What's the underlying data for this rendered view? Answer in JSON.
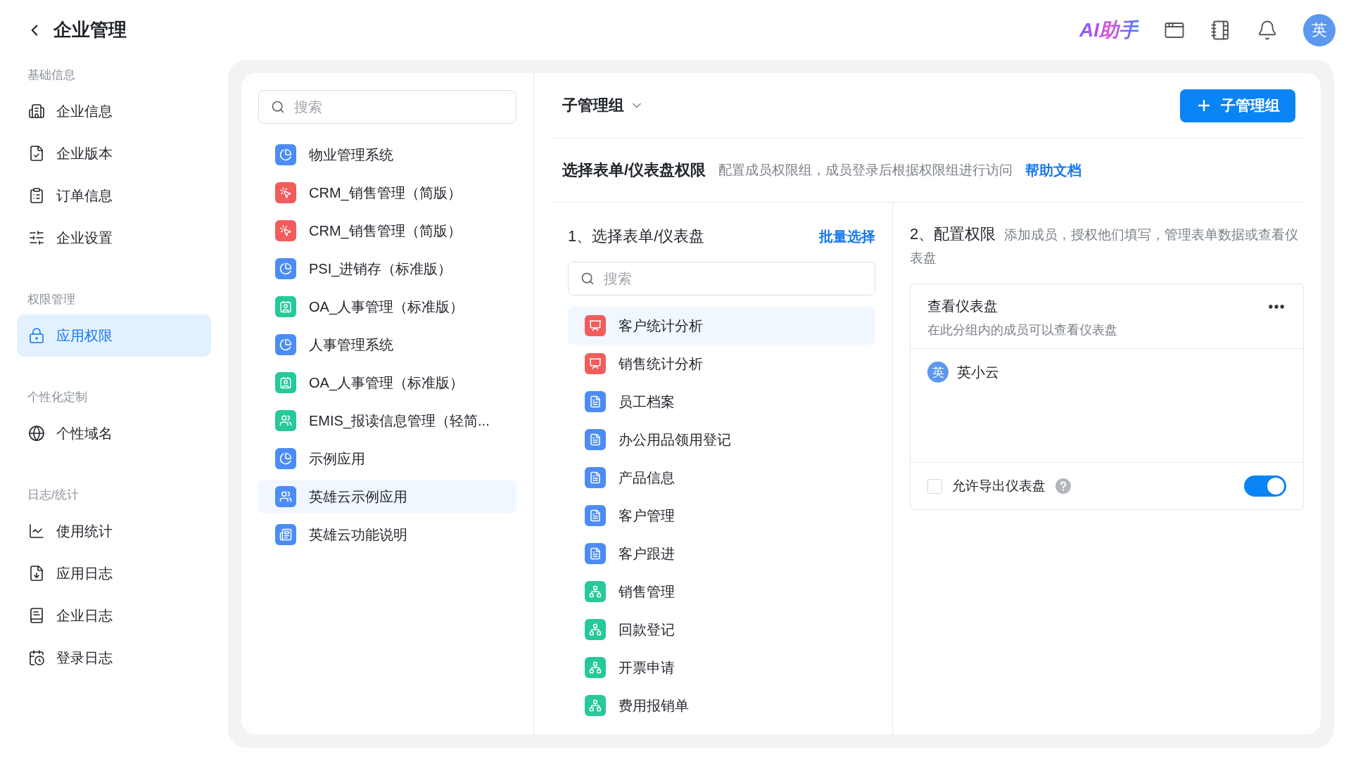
{
  "header": {
    "title": "企业管理",
    "ai_label": "AI助手",
    "avatar": "英"
  },
  "sidebar": {
    "sections": [
      {
        "label": "基础信息",
        "items": [
          {
            "label": "企业信息",
            "selected": false
          },
          {
            "label": "企业版本",
            "selected": false
          },
          {
            "label": "订单信息",
            "selected": false
          },
          {
            "label": "企业设置",
            "selected": false
          }
        ]
      },
      {
        "label": "权限管理",
        "items": [
          {
            "label": "应用权限",
            "selected": true
          }
        ]
      },
      {
        "label": "个性化定制",
        "items": [
          {
            "label": "个性域名",
            "selected": false
          }
        ]
      },
      {
        "label": "日志/统计",
        "items": [
          {
            "label": "使用统计",
            "selected": false
          },
          {
            "label": "应用日志",
            "selected": false
          },
          {
            "label": "企业日志",
            "selected": false
          },
          {
            "label": "登录日志",
            "selected": false
          }
        ]
      }
    ]
  },
  "apps": {
    "search_placeholder": "搜索",
    "items": [
      {
        "label": "物业管理系统",
        "kind": "pie",
        "color": "#4c8cf5",
        "selected": false
      },
      {
        "label": "CRM_销售管理（简版）",
        "kind": "web",
        "color": "#f25c5c",
        "selected": false
      },
      {
        "label": "CRM_销售管理（简版）",
        "kind": "web",
        "color": "#f25c5c",
        "selected": false
      },
      {
        "label": "PSI_进销存（标准版）",
        "kind": "pie",
        "color": "#4c8cf5",
        "selected": false
      },
      {
        "label": "OA_人事管理（标准版）",
        "kind": "contact",
        "color": "#26c99a",
        "selected": false
      },
      {
        "label": "人事管理系统",
        "kind": "pie",
        "color": "#4c8cf5",
        "selected": false
      },
      {
        "label": "OA_人事管理（标准版）",
        "kind": "contact",
        "color": "#26c99a",
        "selected": false
      },
      {
        "label": "EMIS_报读信息管理（轻简...",
        "kind": "team",
        "color": "#26c99a",
        "selected": false
      },
      {
        "label": "示例应用",
        "kind": "pie",
        "color": "#4c8cf5",
        "selected": false
      },
      {
        "label": "英雄云示例应用",
        "kind": "team",
        "color": "#4c8cf5",
        "selected": true
      },
      {
        "label": "英雄云功能说明",
        "kind": "news",
        "color": "#4c8cf5",
        "selected": false
      }
    ]
  },
  "group": {
    "name": "子管理组",
    "add_button": "子管理组"
  },
  "permission": {
    "title": "选择表单/仪表盘权限",
    "description": "配置成员权限组，成员登录后根据权限组进行访问",
    "help_link": "帮助文档"
  },
  "step1": {
    "title": "1、选择表单/仪表盘",
    "batch_link": "批量选择",
    "search_placeholder": "搜索",
    "items": [
      {
        "label": "客户统计分析",
        "kind": "dashboard",
        "selected": true
      },
      {
        "label": "销售统计分析",
        "kind": "dashboard",
        "selected": false
      },
      {
        "label": "员工档案",
        "kind": "form",
        "selected": false
      },
      {
        "label": "办公用品领用登记",
        "kind": "form",
        "selected": false
      },
      {
        "label": "产品信息",
        "kind": "form",
        "selected": false
      },
      {
        "label": "客户管理",
        "kind": "form",
        "selected": false
      },
      {
        "label": "客户跟进",
        "kind": "form",
        "selected": false
      },
      {
        "label": "销售管理",
        "kind": "flow",
        "selected": false
      },
      {
        "label": "回款登记",
        "kind": "flow",
        "selected": false
      },
      {
        "label": "开票申请",
        "kind": "flow",
        "selected": false
      },
      {
        "label": "费用报销单",
        "kind": "flow",
        "selected": false
      }
    ]
  },
  "step2": {
    "title": "2、配置权限",
    "description": "添加成员，授权他们填写，管理表单数据或查看仪表盘",
    "card": {
      "title": "查看仪表盘",
      "description": "在此分组内的成员可以查看仪表盘",
      "members": [
        {
          "avatar": "英",
          "name": "英小云"
        }
      ],
      "export_label": "允许导出仪表盘",
      "export_checked": false,
      "toggle_on": true
    }
  }
}
